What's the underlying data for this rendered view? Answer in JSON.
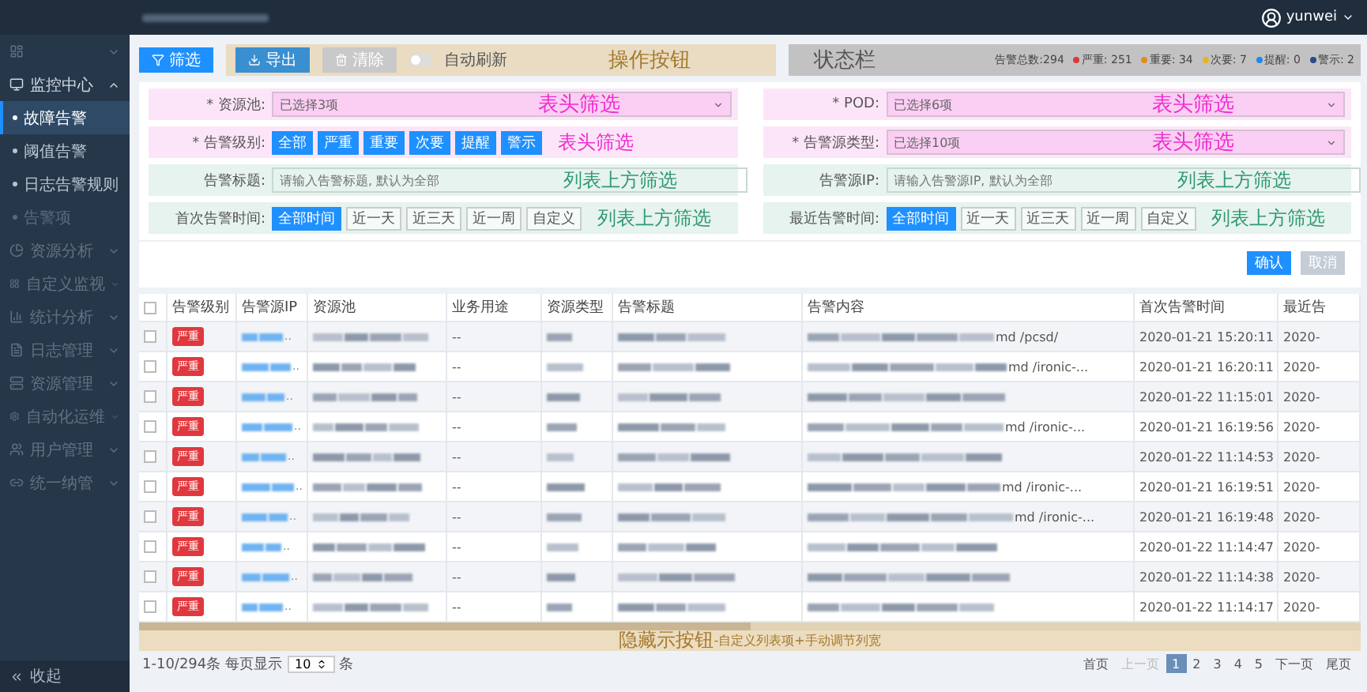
{
  "sidebar": {
    "items": [
      {
        "expanded": false,
        "disabled": true
      },
      {
        "label": "监控中心",
        "expanded": true,
        "disabled": false,
        "children": [
          {
            "label": "故障告警",
            "selected": true,
            "disabled": false
          },
          {
            "label": "阈值告警",
            "selected": false,
            "disabled": false
          },
          {
            "label": "日志告警规则",
            "selected": false,
            "disabled": false
          },
          {
            "label": "告警项",
            "selected": false,
            "disabled": true
          }
        ]
      },
      {
        "label": "资源分析",
        "expanded": false,
        "disabled": true
      },
      {
        "label": "自定义监视",
        "expanded": false,
        "disabled": true
      },
      {
        "label": "统计分析",
        "expanded": false,
        "disabled": true
      },
      {
        "label": "日志管理",
        "expanded": false,
        "disabled": true
      },
      {
        "label": "资源管理",
        "expanded": false,
        "disabled": true
      },
      {
        "label": "自动化运维",
        "expanded": false,
        "disabled": true
      },
      {
        "label": "用户管理",
        "expanded": false,
        "disabled": true
      },
      {
        "label": "统一纳管",
        "expanded": false,
        "disabled": true
      }
    ],
    "collapse": "收起"
  },
  "user": {
    "name": "yunwei"
  },
  "toolbar": {
    "buttons": [
      {
        "label": "筛选",
        "disabled": false,
        "kind": "filter"
      },
      {
        "label": "导出",
        "disabled": false,
        "kind": "export"
      },
      {
        "label": "清除",
        "disabled": true,
        "kind": "clear"
      }
    ],
    "auto_refresh": {
      "label": "自动刷新",
      "on": false
    },
    "annotation": "操作按钮"
  },
  "status_bar": {
    "annotation": "状态栏",
    "total": "告警总数:294",
    "counts": [
      {
        "label": "严重: 251",
        "color": "#d9363e"
      },
      {
        "label": "重要: 34",
        "color": "#e58a1f"
      },
      {
        "label": "次要: 7",
        "color": "#e6b422"
      },
      {
        "label": "提醒: 0",
        "color": "#1e88e5"
      },
      {
        "label": "警示: 2",
        "color": "#2a4a8a"
      }
    ]
  },
  "filters": {
    "left": [
      {
        "color": "#f02bd0",
        "kind": "select",
        "label": "* 资源池:",
        "value": "已选择3项",
        "annotation": "表头筛选"
      },
      {
        "color": "#f02bd0",
        "kind": "buttons",
        "label": "* 告警级别:",
        "options": [
          {
            "label": "全部",
            "selected": true
          },
          {
            "label": "严重",
            "selected": true
          },
          {
            "label": "重要",
            "selected": true
          },
          {
            "label": "次要",
            "selected": true
          },
          {
            "label": "提醒",
            "selected": true
          },
          {
            "label": "警示",
            "selected": true
          }
        ],
        "annotation": "表头筛选"
      },
      {
        "color": "#2f9a72",
        "kind": "input",
        "label": "告警标题:",
        "placeholder": "请输入告警标题, 默认为全部",
        "annotation": "列表上方筛选"
      },
      {
        "color": "#2f9a72",
        "kind": "buttons",
        "label": "首次告警时间:",
        "options": [
          {
            "label": "全部时间",
            "selected": true
          },
          {
            "label": "近一天",
            "selected": false
          },
          {
            "label": "近三天",
            "selected": false
          },
          {
            "label": "近一周",
            "selected": false
          },
          {
            "label": "自定义",
            "selected": false
          }
        ],
        "annotation": "列表上方筛选"
      }
    ],
    "right": [
      {
        "color": "#f02bd0",
        "kind": "select",
        "label": "* POD:",
        "value": "已选择6项",
        "annotation": "表头筛选"
      },
      {
        "color": "#f02bd0",
        "kind": "select",
        "label": "* 告警源类型:",
        "value": "已选择10项",
        "annotation": "表头筛选"
      },
      {
        "color": "#2f9a72",
        "kind": "input",
        "label": "告警源IP:",
        "placeholder": "请输入告警源IP, 默认为全部",
        "annotation": "列表上方筛选"
      },
      {
        "color": "#2f9a72",
        "kind": "buttons",
        "label": "最近告警时间:",
        "options": [
          {
            "label": "全部时间",
            "selected": true
          },
          {
            "label": "近一天",
            "selected": false
          },
          {
            "label": "近三天",
            "selected": false
          },
          {
            "label": "近一周",
            "selected": false
          },
          {
            "label": "自定义",
            "selected": false
          }
        ],
        "annotation": "列表上方筛选"
      }
    ]
  },
  "actions": [
    {
      "label": "确认",
      "disabled": false
    },
    {
      "label": "取消",
      "disabled": true
    }
  ],
  "table": {
    "all_checked": false,
    "columns": [
      "告警级别",
      "告警源IP",
      "资源池",
      "业务用途",
      "资源类型",
      "告警标题",
      "告警内容",
      "首次告警时间",
      "最近告"
    ],
    "rows": [
      {
        "checked": false,
        "level": "严重",
        "ip_tail": "..",
        "purpose": "--",
        "content_tail": "md /pcsd/",
        "first_time": "2020-01-21 15:20:11",
        "last_time": "2020-"
      },
      {
        "checked": false,
        "level": "严重",
        "ip_tail": "..",
        "purpose": "--",
        "content_tail": "md /ironic-...",
        "first_time": "2020-01-21 16:20:11",
        "last_time": "2020-"
      },
      {
        "checked": false,
        "level": "严重",
        "ip_tail": "..",
        "purpose": "--",
        "first_time": "2020-01-22 11:15:01",
        "last_time": "2020-"
      },
      {
        "checked": false,
        "level": "严重",
        "ip_tail": "..",
        "purpose": "--",
        "content_tail": "md /ironic-...",
        "first_time": "2020-01-21 16:19:56",
        "last_time": "2020-"
      },
      {
        "checked": false,
        "level": "严重",
        "ip_tail": "..",
        "purpose": "--",
        "first_time": "2020-01-22 11:14:53",
        "last_time": "2020-"
      },
      {
        "checked": false,
        "level": "严重",
        "ip_tail": "..",
        "purpose": "--",
        "content_tail": "md /ironic-...",
        "first_time": "2020-01-21 16:19:51",
        "last_time": "2020-"
      },
      {
        "checked": false,
        "level": "严重",
        "ip_tail": "..",
        "purpose": "--",
        "content_tail": "md /ironic-...",
        "first_time": "2020-01-21 16:19:48",
        "last_time": "2020-"
      },
      {
        "checked": false,
        "level": "严重",
        "ip_tail": "..",
        "purpose": "--",
        "first_time": "2020-01-22 11:14:47",
        "last_time": "2020-"
      },
      {
        "checked": false,
        "level": "严重",
        "ip_tail": "..",
        "purpose": "--",
        "first_time": "2020-01-22 11:14:38",
        "last_time": "2020-"
      },
      {
        "checked": false,
        "level": "严重",
        "ip_tail": "..",
        "purpose": "--",
        "first_time": "2020-01-22 11:14:17",
        "last_time": "2020-"
      }
    ]
  },
  "column_band": {
    "annotation": "隐藏示按钮",
    "note": "-自定义列表项+手动调节列宽",
    "level": 0.5
  },
  "pagination": {
    "range": "1-10/294条",
    "per_page_label": "每页显示",
    "per_page": "10",
    "unit": "条",
    "pages": [
      {
        "label": "首页",
        "selected": false,
        "disabled": false
      },
      {
        "label": "上一页",
        "selected": false,
        "disabled": true
      },
      {
        "label": "1",
        "selected": true,
        "disabled": false
      },
      {
        "label": "2",
        "selected": false,
        "disabled": false
      },
      {
        "label": "3",
        "selected": false,
        "disabled": false
      },
      {
        "label": "4",
        "selected": false,
        "disabled": false
      },
      {
        "label": "5",
        "selected": false,
        "disabled": false
      },
      {
        "label": "下一页",
        "selected": false,
        "disabled": false
      },
      {
        "label": "尾页",
        "selected": false,
        "disabled": false
      }
    ]
  }
}
